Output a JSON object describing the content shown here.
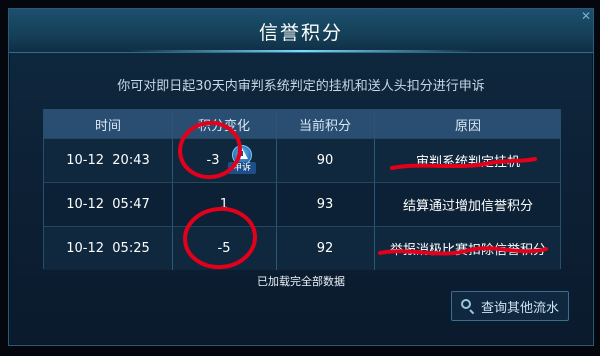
{
  "dialog": {
    "title": "信誉积分",
    "subtitle": "你可对即日起30天内审判系统判定的挂机和送人头扣分进行申诉",
    "close_icon": "close-icon"
  },
  "table": {
    "headers": [
      "时间",
      "积分变化",
      "当前积分",
      "原因"
    ],
    "rows": [
      {
        "date": "10-12",
        "time": "20:43",
        "change": "-3",
        "current": "90",
        "reason": "审判系统判定挂机",
        "appeal_label": "申诉"
      },
      {
        "date": "10-12",
        "time": "05:47",
        "change": "1",
        "current": "93",
        "reason": "结算通过增加信誉积分"
      },
      {
        "date": "10-12",
        "time": "05:25",
        "change": "-5",
        "current": "92",
        "reason": "举报消极比赛扣除信誉积分"
      }
    ]
  },
  "footer": {
    "loaded_text": "已加载完全部数据",
    "query_button": "查询其他流水"
  },
  "colors": {
    "accent": "#7fdcff",
    "header_bg": "#2a4e72",
    "annotation_red": "#e3001b"
  }
}
